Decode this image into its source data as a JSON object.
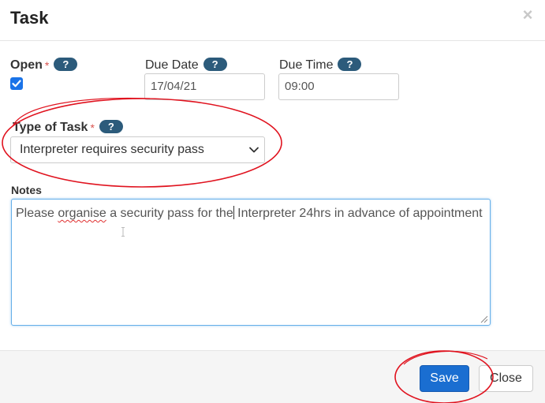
{
  "dialog": {
    "title": "Task",
    "close_glyph": "×"
  },
  "form": {
    "open": {
      "label": "Open",
      "required_marker": "*",
      "help": "?",
      "checked": true
    },
    "due_date": {
      "label": "Due Date",
      "help": "?",
      "value": "17/04/21"
    },
    "due_time": {
      "label": "Due Time",
      "help": "?",
      "value": "09:00"
    },
    "type_of_task": {
      "label": "Type of Task",
      "required_marker": "*",
      "help": "?",
      "selected": "Interpreter requires security pass"
    },
    "notes": {
      "label": "Notes",
      "text_before": "Please ",
      "misspelled_word": "organise",
      "text_middle": " a security pass for the",
      "text_after": " Interpreter 24hrs in advance of appointment"
    }
  },
  "footer": {
    "save_label": "Save",
    "close_label": "Close"
  },
  "colors": {
    "primary_button": "#1a6ed1",
    "help_badge": "#2c5b7b",
    "required_marker": "#d9534f",
    "annotation_circle": "#e0131f",
    "focus_border": "#66afe9"
  },
  "icons": {
    "close": "close-icon",
    "help": "question-icon",
    "checkbox": "checkmark-icon",
    "select": "chevron-down-icon",
    "resize": "resize-grip-icon",
    "cursor": "text-cursor-icon"
  }
}
